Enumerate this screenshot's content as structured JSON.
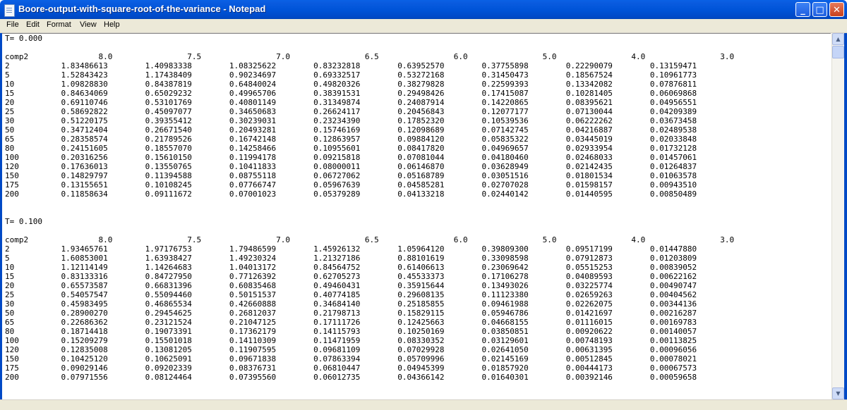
{
  "window": {
    "title": "Boore-output-with-square-root-of-the-variance - Notepad",
    "minimize_glyph": "_",
    "maximize_glyph": "□",
    "close_glyph": "✕",
    "icon": "notepad-icon"
  },
  "menu": [
    "File",
    "Edit",
    "Format",
    "View",
    "Help"
  ],
  "scrollbar": {
    "up_glyph": "▲",
    "down_glyph": "▼"
  },
  "colors": {
    "titlebar": "#0054d8",
    "menubar": "#ece9d8",
    "close_button": "#c6401e"
  },
  "document": {
    "column_label": "comp2",
    "magnitudes": [
      "8.0",
      "7.5",
      "7.0",
      "6.5",
      "6.0",
      "5.0",
      "4.0",
      "3.0"
    ],
    "blocks": [
      {
        "header": "T= 0.000",
        "rows": [
          [
            "2",
            "1.83486613",
            "1.40983338",
            "1.08325622",
            "0.83232818",
            "0.63952570",
            "0.37755898",
            "0.22290079",
            "0.13159471"
          ],
          [
            "5",
            "1.52843423",
            "1.17438409",
            "0.90234697",
            "0.69332517",
            "0.53272168",
            "0.31450473",
            "0.18567524",
            "0.10961773"
          ],
          [
            "10",
            "1.09828830",
            "0.84387819",
            "0.64840024",
            "0.49820326",
            "0.38279828",
            "0.22599393",
            "0.13342082",
            "0.07876811"
          ],
          [
            "15",
            "0.84634069",
            "0.65029232",
            "0.49965706",
            "0.38391531",
            "0.29498426",
            "0.17415087",
            "0.10281405",
            "0.06069868"
          ],
          [
            "20",
            "0.69110746",
            "0.53101769",
            "0.40801149",
            "0.31349874",
            "0.24087914",
            "0.14220865",
            "0.08395621",
            "0.04956551"
          ],
          [
            "25",
            "0.58692822",
            "0.45097077",
            "0.34650683",
            "0.26624117",
            "0.20456843",
            "0.12077177",
            "0.07130044",
            "0.04209389"
          ],
          [
            "30",
            "0.51220175",
            "0.39355412",
            "0.30239031",
            "0.23234390",
            "0.17852320",
            "0.10539536",
            "0.06222262",
            "0.03673458"
          ],
          [
            "50",
            "0.34712404",
            "0.26671540",
            "0.20493281",
            "0.15746169",
            "0.12098689",
            "0.07142745",
            "0.04216887",
            "0.02489538"
          ],
          [
            "65",
            "0.28358574",
            "0.21789526",
            "0.16742148",
            "0.12863957",
            "0.09884120",
            "0.05835322",
            "0.03445019",
            "0.02033848"
          ],
          [
            "80",
            "0.24151605",
            "0.18557070",
            "0.14258466",
            "0.10955601",
            "0.08417820",
            "0.04969657",
            "0.02933954",
            "0.01732128"
          ],
          [
            "100",
            "0.20316256",
            "0.15610150",
            "0.11994178",
            "0.09215818",
            "0.07081044",
            "0.04180460",
            "0.02468033",
            "0.01457061"
          ],
          [
            "120",
            "0.17636013",
            "0.13550765",
            "0.10411833",
            "0.08000011",
            "0.06146870",
            "0.03628949",
            "0.02142435",
            "0.01264837"
          ],
          [
            "150",
            "0.14829797",
            "0.11394588",
            "0.08755118",
            "0.06727062",
            "0.05168789",
            "0.03051516",
            "0.01801534",
            "0.01063578"
          ],
          [
            "175",
            "0.13155651",
            "0.10108245",
            "0.07766747",
            "0.05967639",
            "0.04585281",
            "0.02707028",
            "0.01598157",
            "0.00943510"
          ],
          [
            "200",
            "0.11858634",
            "0.09111672",
            "0.07001023",
            "0.05379289",
            "0.04133218",
            "0.02440142",
            "0.01440595",
            "0.00850489"
          ]
        ]
      },
      {
        "header": "T= 0.100",
        "rows": [
          [
            "2",
            "1.93465761",
            "1.97176753",
            "1.79486599",
            "1.45926132",
            "1.05964120",
            "0.39809300",
            "0.09517199",
            "0.01447880"
          ],
          [
            "5",
            "1.60853001",
            "1.63938427",
            "1.49230324",
            "1.21327186",
            "0.88101619",
            "0.33098598",
            "0.07912873",
            "0.01203809"
          ],
          [
            "10",
            "1.12114149",
            "1.14264683",
            "1.04013172",
            "0.84564752",
            "0.61406613",
            "0.23069642",
            "0.05515253",
            "0.00839052"
          ],
          [
            "15",
            "0.83133316",
            "0.84727950",
            "0.77126392",
            "0.62705273",
            "0.45533373",
            "0.17106278",
            "0.04089593",
            "0.00622162"
          ],
          [
            "20",
            "0.65573587",
            "0.66831396",
            "0.60835468",
            "0.49460431",
            "0.35915644",
            "0.13493026",
            "0.03225774",
            "0.00490747"
          ],
          [
            "25",
            "0.54057547",
            "0.55094460",
            "0.50151537",
            "0.40774185",
            "0.29608135",
            "0.11123380",
            "0.02659263",
            "0.00404562"
          ],
          [
            "30",
            "0.45983495",
            "0.46865534",
            "0.42660888",
            "0.34684140",
            "0.25185855",
            "0.09461988",
            "0.02262075",
            "0.00344136"
          ],
          [
            "50",
            "0.28900270",
            "0.29454625",
            "0.26812037",
            "0.21798713",
            "0.15829115",
            "0.05946786",
            "0.01421697",
            "0.00216287"
          ],
          [
            "65",
            "0.22686362",
            "0.23121524",
            "0.21047125",
            "0.17111726",
            "0.12425663",
            "0.04668155",
            "0.01116015",
            "0.00169783"
          ],
          [
            "80",
            "0.18714418",
            "0.19073391",
            "0.17362179",
            "0.14115793",
            "0.10250169",
            "0.03850851",
            "0.00920622",
            "0.00140057"
          ],
          [
            "100",
            "0.15209279",
            "0.15501018",
            "0.14110309",
            "0.11471959",
            "0.08330352",
            "0.03129601",
            "0.00748193",
            "0.00113825"
          ],
          [
            "120",
            "0.12835008",
            "0.13081205",
            "0.11907595",
            "0.09681109",
            "0.07029928",
            "0.02641050",
            "0.00631395",
            "0.00096056"
          ],
          [
            "150",
            "0.10425120",
            "0.10625091",
            "0.09671838",
            "0.07863394",
            "0.05709996",
            "0.02145169",
            "0.00512845",
            "0.00078021"
          ],
          [
            "175",
            "0.09029146",
            "0.09202339",
            "0.08376731",
            "0.06810447",
            "0.04945399",
            "0.01857920",
            "0.00444173",
            "0.00067573"
          ],
          [
            "200",
            "0.07971556",
            "0.08124464",
            "0.07395560",
            "0.06012735",
            "0.04366142",
            "0.01640301",
            "0.00392146",
            "0.00059658"
          ]
        ]
      }
    ]
  },
  "editor_text": ""
}
